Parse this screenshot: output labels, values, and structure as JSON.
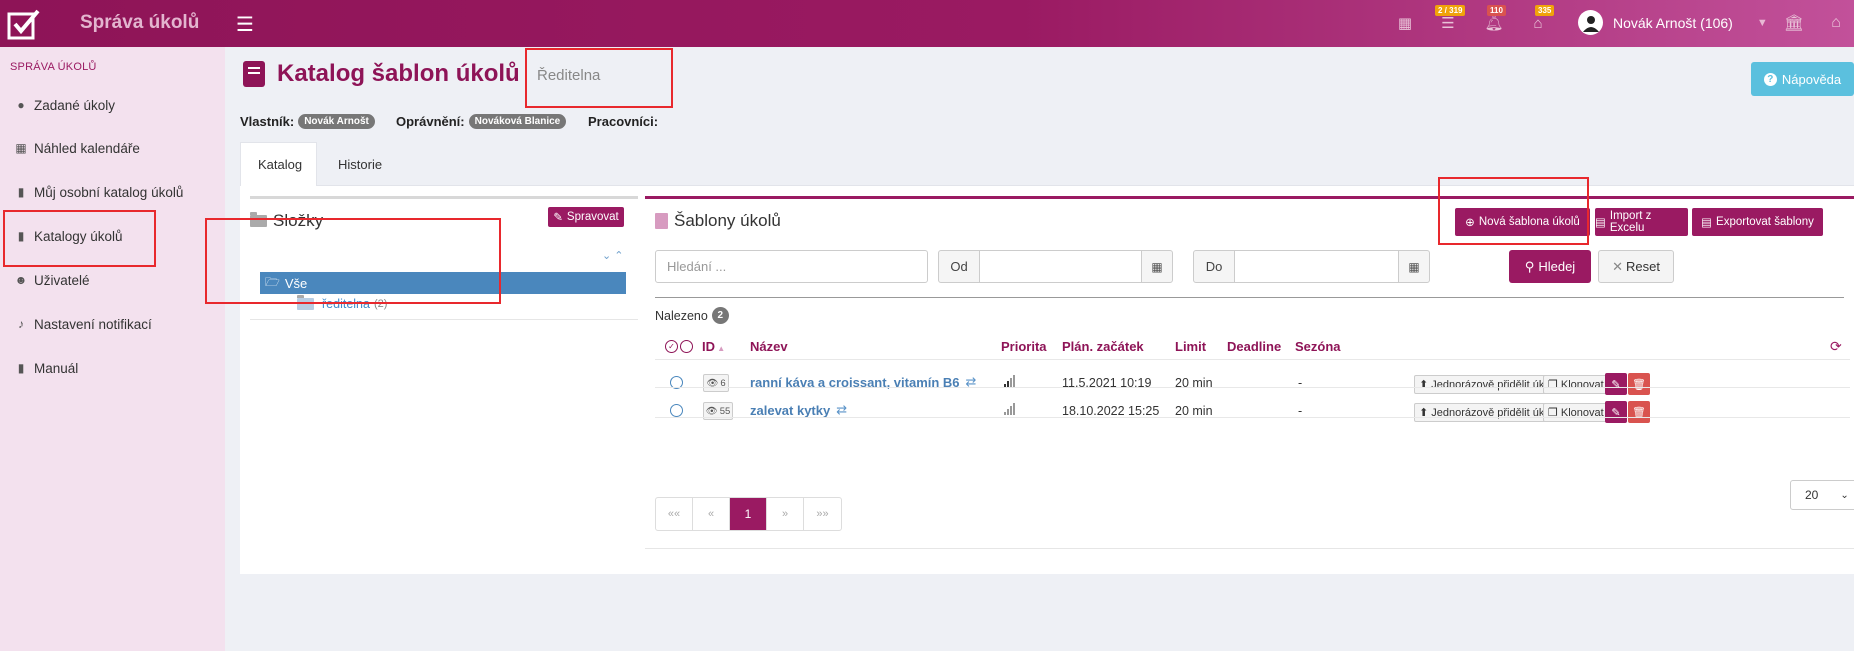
{
  "app": {
    "title": "Správa úkolů",
    "badges": {
      "tasks": "2 / 319",
      "notifications": "110",
      "home": "335"
    },
    "user": "Novák Arnošt (106)"
  },
  "sidebar": {
    "header": "SPRÁVA ÚKOLŮ",
    "items": [
      {
        "label": "Zadané úkoly",
        "icon": "check-circle-icon"
      },
      {
        "label": "Náhled kalendáře",
        "icon": "calendar-icon"
      },
      {
        "label": "Můj osobní katalog úkolů",
        "icon": "book-icon"
      },
      {
        "label": "Katalogy úkolů",
        "icon": "book-icon"
      },
      {
        "label": "Uživatelé",
        "icon": "users-icon"
      },
      {
        "label": "Nastavení notifikací",
        "icon": "bell-icon"
      },
      {
        "label": "Manuál",
        "icon": "book-icon"
      }
    ]
  },
  "page": {
    "title": "Katalog šablon úkolů",
    "catalog_name": "Ředitelna",
    "help": "Nápověda",
    "owner_label": "Vlastník:",
    "owner": "Novák Arnošt",
    "permission_label": "Oprávnění:",
    "permission": "Nováková Blanice",
    "workers_label": "Pracovníci:"
  },
  "tabs": [
    "Katalog",
    "Historie"
  ],
  "folders": {
    "title": "Složky",
    "manage": "Spravovat",
    "all": "Vše",
    "sub": "ředitelna",
    "sub_count": "(2)"
  },
  "templates": {
    "title": "Šablony úkolů",
    "new": "Nová šablona úkolů",
    "import": "Import z Excelu",
    "export": "Exportovat šablony",
    "search_placeholder": "Hledání ...",
    "from": "Od",
    "to": "Do",
    "search_btn": "Hledej",
    "reset_btn": "Reset",
    "found_label": "Nalezeno",
    "found_count": "2",
    "columns": {
      "id": "ID",
      "name": "Název",
      "priority": "Priorita",
      "start": "Plán. začátek",
      "limit": "Limit",
      "deadline": "Deadline",
      "season": "Sezóna"
    },
    "rows": [
      {
        "views": "6",
        "name": "ranní káva a croissant, vitamín B6",
        "start": "11.5.2021 10:19",
        "limit": "20 min",
        "season": "-"
      },
      {
        "views": "55",
        "name": "zalevat kytky",
        "start": "18.10.2022 15:25",
        "limit": "20 min",
        "season": "-"
      }
    ],
    "assign": "Jednorázově přidělit úkol",
    "clone": "Klonovat",
    "pager": [
      "««",
      "«",
      "1",
      "»",
      "»»"
    ],
    "page_size": "20"
  }
}
